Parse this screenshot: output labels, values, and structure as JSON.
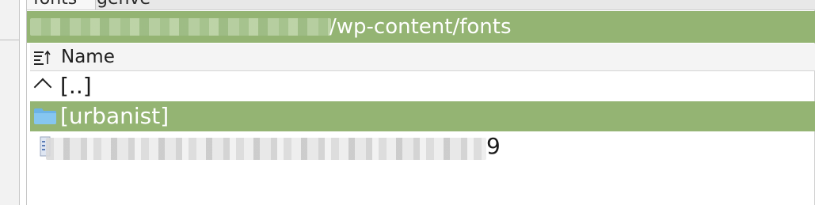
{
  "tabs": {
    "active_label": "fonts",
    "second_label": "genve"
  },
  "pathbar": {
    "path_suffix": "/wp-content/fonts"
  },
  "columns": {
    "name_label": "Name"
  },
  "rows": [
    {
      "label": "[..]",
      "icon": "parent-dir-icon"
    },
    {
      "label": "[urbanist]",
      "icon": "folder-icon",
      "selected": true
    },
    {
      "label": "9",
      "icon": "file-icon"
    }
  ],
  "colors": {
    "accent": "#94b473",
    "selection_text": "#ffffff"
  }
}
